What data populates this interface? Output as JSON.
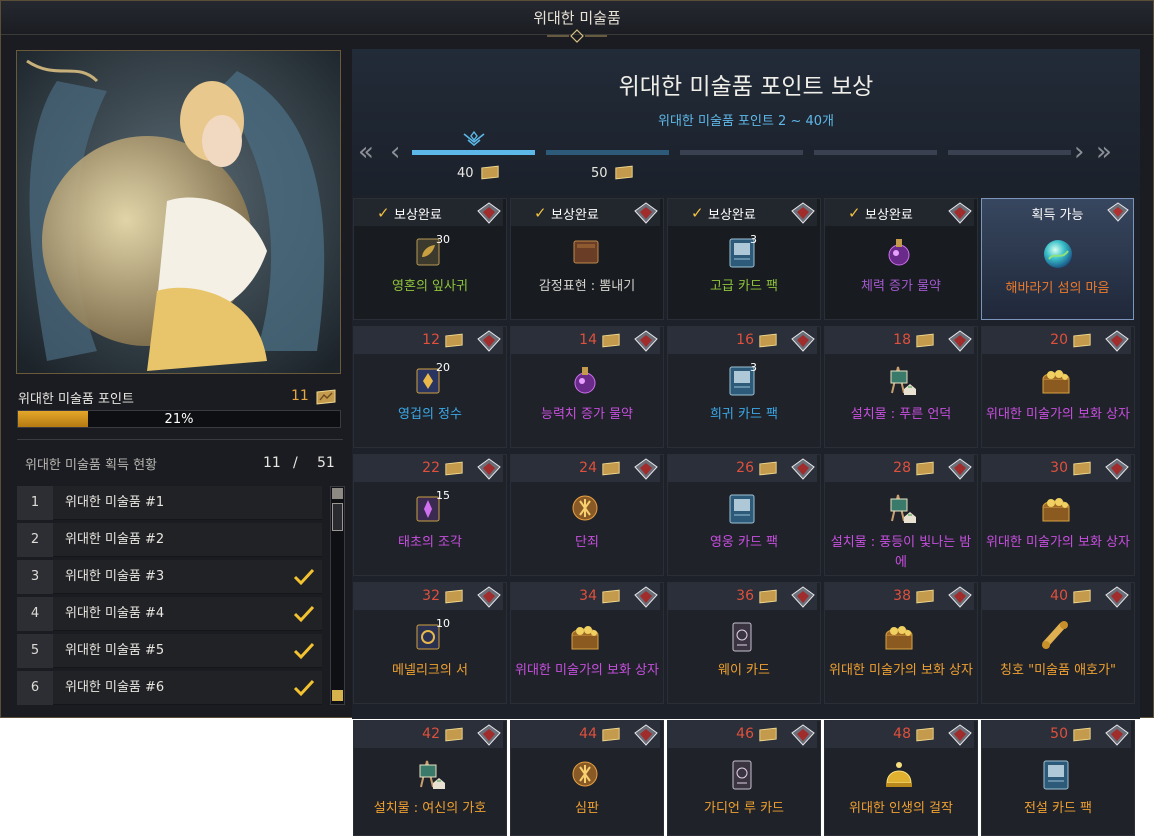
{
  "window": {
    "title": "위대한 미술품"
  },
  "left": {
    "points_label": "위대한 미술품 포인트",
    "points_value": "11",
    "progress_percent": 21,
    "progress_text": "21%",
    "acq_label": "위대한 미술품 획득 현황",
    "acq_count": "11",
    "acq_sep": "/",
    "acq_total": "51",
    "list": [
      {
        "num": "1",
        "name": "위대한 미술품 #1",
        "checked": false
      },
      {
        "num": "2",
        "name": "위대한 미술품 #2",
        "checked": false
      },
      {
        "num": "3",
        "name": "위대한 미술품 #3",
        "checked": true
      },
      {
        "num": "4",
        "name": "위대한 미술품 #4",
        "checked": true
      },
      {
        "num": "5",
        "name": "위대한 미술품 #5",
        "checked": true
      },
      {
        "num": "6",
        "name": "위대한 미술품 #6",
        "checked": true
      }
    ]
  },
  "right": {
    "title": "위대한 미술품 포인트 보상",
    "subtitle": "위대한 미술품 포인트 2 ~ 40개",
    "seg_labels": [
      "40",
      "50"
    ],
    "status_done": "보상완료",
    "status_available": "획득 가능",
    "row1": [
      {
        "name": "영혼의 잎사귀",
        "count": "30",
        "color": "#8fc43c",
        "icon": "leaf-book-icon"
      },
      {
        "name": "감정표현 : 뽐내기",
        "count": "",
        "color": "#d6d4ce",
        "icon": "emote-book-icon"
      },
      {
        "name": "고급 카드 팩",
        "count": "3",
        "color": "#8fc43c",
        "icon": "card-pack-icon"
      },
      {
        "name": "체력 증가 물약",
        "count": "",
        "color": "#a45ad0",
        "icon": "potion-icon"
      }
    ],
    "available": {
      "name": "해바라기 섬의 마음",
      "color": "#ef7a2a",
      "icon": "orb-icon"
    },
    "grid": [
      {
        "lvl": "12",
        "name": "영겁의 정수",
        "count": "20",
        "color": "#3ba8e8",
        "icon": "essence-icon"
      },
      {
        "lvl": "14",
        "name": "능력치 증가 물약",
        "count": "",
        "color": "#c84ee0",
        "icon": "potion-icon"
      },
      {
        "lvl": "16",
        "name": "희귀 카드 팩",
        "count": "3",
        "color": "#3ba8e8",
        "icon": "card-pack-icon"
      },
      {
        "lvl": "18",
        "name": "설치물 : 푸른 언덕",
        "count": "",
        "color": "#c84ee0",
        "icon": "easel-icon"
      },
      {
        "lvl": "20",
        "name": "위대한 미술가의 보화 상자",
        "count": "",
        "color": "#c84ee0",
        "icon": "treasure-chest-icon"
      },
      {
        "lvl": "22",
        "name": "태초의 조각",
        "count": "15",
        "color": "#c84ee0",
        "icon": "shard-icon"
      },
      {
        "lvl": "24",
        "name": "단죄",
        "count": "",
        "color": "#c84ee0",
        "icon": "rune-icon"
      },
      {
        "lvl": "26",
        "name": "영웅 카드 팩",
        "count": "",
        "color": "#c84ee0",
        "icon": "card-pack-icon"
      },
      {
        "lvl": "28",
        "name": "설치물 : 풍등이 빛나는 밤에",
        "count": "",
        "color": "#c84ee0",
        "icon": "easel-icon"
      },
      {
        "lvl": "30",
        "name": "위대한 미술가의 보화 상자",
        "count": "",
        "color": "#c84ee0",
        "icon": "treasure-chest-icon"
      },
      {
        "lvl": "32",
        "name": "메넬리크의 서",
        "count": "10",
        "color": "#f0a030",
        "icon": "tome-icon"
      },
      {
        "lvl": "34",
        "name": "위대한 미술가의 보화 상자",
        "count": "",
        "color": "#c84ee0",
        "icon": "treasure-chest-icon"
      },
      {
        "lvl": "36",
        "name": "웨이 카드",
        "count": "",
        "color": "#f0a030",
        "icon": "tarot-card-icon"
      },
      {
        "lvl": "38",
        "name": "위대한 미술가의 보화 상자",
        "count": "",
        "color": "#f0a030",
        "icon": "treasure-chest-icon"
      },
      {
        "lvl": "40",
        "name": "칭호 \"미술품 애호가\"",
        "count": "",
        "color": "#f0a030",
        "icon": "scroll-icon"
      },
      {
        "lvl": "42",
        "name": "설치물 : 여신의 가호",
        "count": "",
        "color": "#f0a030",
        "icon": "easel-icon"
      },
      {
        "lvl": "44",
        "name": "심판",
        "count": "",
        "color": "#f0a030",
        "icon": "rune-icon"
      },
      {
        "lvl": "46",
        "name": "가디언 루 카드",
        "count": "",
        "color": "#f0a030",
        "icon": "tarot-card-icon"
      },
      {
        "lvl": "48",
        "name": "위대한 인생의 걸작",
        "count": "",
        "color": "#f0a030",
        "icon": "golden-dome-icon"
      },
      {
        "lvl": "50",
        "name": "전설 카드 팩",
        "count": "",
        "color": "#f0a030",
        "icon": "card-pack-icon"
      }
    ]
  },
  "colors": {
    "accent": "#e8a640",
    "level": "#e0503c",
    "sub": "#5fb8e8"
  }
}
